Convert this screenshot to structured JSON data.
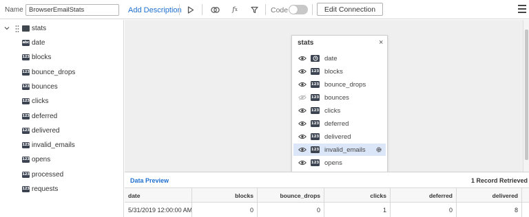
{
  "toolbar": {
    "name_label": "Name",
    "name_value": "BrowserEmailStats",
    "add_description": "Add Description",
    "code_label": "Code",
    "code_toggle_on": false,
    "edit_connection": "Edit Connection",
    "icons": [
      "play-icon",
      "filter-icon",
      "fx-icon",
      "funnel-icon",
      "menu-icon"
    ]
  },
  "tree": {
    "root": "stats",
    "fields": [
      {
        "label": "date",
        "type": "abc"
      },
      {
        "label": "blocks",
        "type": "123"
      },
      {
        "label": "bounce_drops",
        "type": "123"
      },
      {
        "label": "bounces",
        "type": "123"
      },
      {
        "label": "clicks",
        "type": "123"
      },
      {
        "label": "deferred",
        "type": "123"
      },
      {
        "label": "delivered",
        "type": "123"
      },
      {
        "label": "invalid_emails",
        "type": "123"
      },
      {
        "label": "opens",
        "type": "123"
      },
      {
        "label": "processed",
        "type": "123"
      },
      {
        "label": "requests",
        "type": "123"
      }
    ]
  },
  "card": {
    "title": "stats",
    "close": "×",
    "rows": [
      {
        "label": "date",
        "type": "clock",
        "visible": true
      },
      {
        "label": "blocks",
        "type": "123",
        "visible": true
      },
      {
        "label": "bounce_drops",
        "type": "123",
        "visible": true
      },
      {
        "label": "bounces",
        "type": "123",
        "visible": false
      },
      {
        "label": "clicks",
        "type": "123",
        "visible": true
      },
      {
        "label": "deferred",
        "type": "123",
        "visible": true
      },
      {
        "label": "delivered",
        "type": "123",
        "visible": true
      },
      {
        "label": "invalid_emails",
        "type": "123",
        "visible": true,
        "selected": true
      },
      {
        "label": "opens",
        "type": "123",
        "visible": true
      }
    ]
  },
  "preview": {
    "title": "Data Preview",
    "count": "1 Record Retrieved",
    "columns": [
      "date",
      "blocks",
      "bounce_drops",
      "clicks",
      "deferred",
      "delivered"
    ],
    "rows": [
      [
        "5/31/2019 12:00:00 AM",
        "0",
        "0",
        "1",
        "0",
        "8"
      ]
    ]
  },
  "colors": {
    "accent": "#1e6fd0",
    "badge": "#3b4450",
    "selected_row": "#dbe6f8",
    "canvas": "#efefef"
  }
}
